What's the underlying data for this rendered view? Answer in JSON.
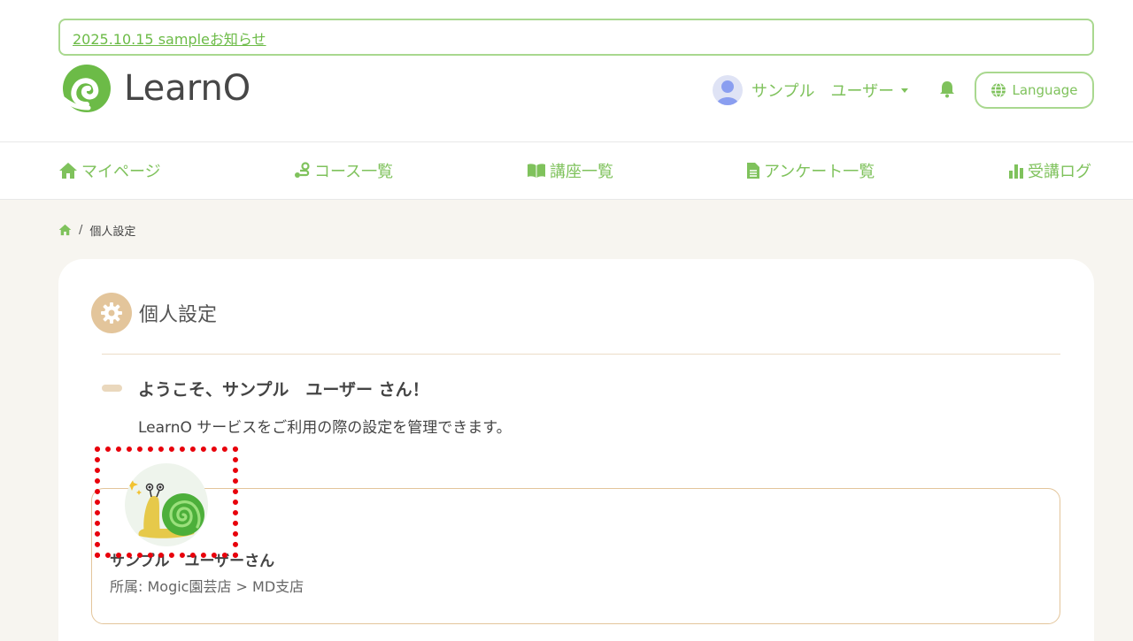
{
  "notice": {
    "text": "2025.10.15 sampleお知らせ"
  },
  "brand": {
    "name": "LearnO"
  },
  "header": {
    "user_name": "サンプル　ユーザー",
    "language_label": "Language"
  },
  "nav": {
    "items": [
      {
        "label": "マイページ",
        "icon": "home-icon"
      },
      {
        "label": "コース一覧",
        "icon": "route-icon"
      },
      {
        "label": "講座一覧",
        "icon": "book-icon"
      },
      {
        "label": "アンケート一覧",
        "icon": "file-icon"
      },
      {
        "label": "受講ログ",
        "icon": "chart-icon"
      }
    ]
  },
  "breadcrumb": {
    "separator": "/",
    "current": "個人設定"
  },
  "page": {
    "title": "個人設定",
    "welcome": "ようこそ、サンプル　ユーザー さん！",
    "subtitle": "LearnO サービスをご利用の際の設定を管理できます。"
  },
  "profile": {
    "name": "サンプル　ユーザーさん",
    "affiliation": "所属: Mogic園芸店 > MD支店"
  },
  "colors": {
    "accent_green": "#7fc25c",
    "border_green": "#a9d88f",
    "beige": "#e3c59b",
    "highlight_red": "#e8000b"
  }
}
